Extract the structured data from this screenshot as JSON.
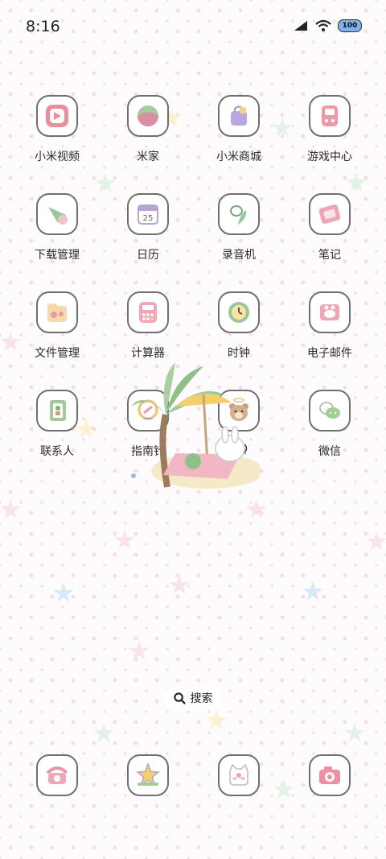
{
  "status_bar": {
    "time": "8:16",
    "battery": "100"
  },
  "apps": [
    {
      "label": "小米视频",
      "icon": "video-icon"
    },
    {
      "label": "米家",
      "icon": "home-ball-icon"
    },
    {
      "label": "小米商城",
      "icon": "shopping-bag-icon"
    },
    {
      "label": "游戏中心",
      "icon": "game-console-icon"
    },
    {
      "label": "下载管理",
      "icon": "download-icon"
    },
    {
      "label": "日历",
      "icon": "calendar-icon",
      "day": "25"
    },
    {
      "label": "录音机",
      "icon": "recorder-icon"
    },
    {
      "label": "笔记",
      "icon": "notes-icon"
    },
    {
      "label": "文件管理",
      "icon": "folder-icon"
    },
    {
      "label": "计算器",
      "icon": "calculator-icon"
    },
    {
      "label": "时钟",
      "icon": "clock-icon"
    },
    {
      "label": "电子邮件",
      "icon": "mail-icon"
    },
    {
      "label": "联系人",
      "icon": "contacts-icon"
    },
    {
      "label": "指南针",
      "icon": "compass-icon"
    },
    {
      "label": "QQ",
      "icon": "bear-icon"
    },
    {
      "label": "微信",
      "icon": "wechat-icon"
    }
  ],
  "search": {
    "label": "搜索"
  },
  "dock": [
    {
      "icon": "phone-icon"
    },
    {
      "icon": "star-icon"
    },
    {
      "icon": "cat-message-icon"
    },
    {
      "icon": "camera-icon"
    }
  ],
  "colors": {
    "pink": "#f2c6cf",
    "mint": "#d8efe3",
    "blue": "#cfe3f6",
    "yellow": "#f7ecb8"
  }
}
